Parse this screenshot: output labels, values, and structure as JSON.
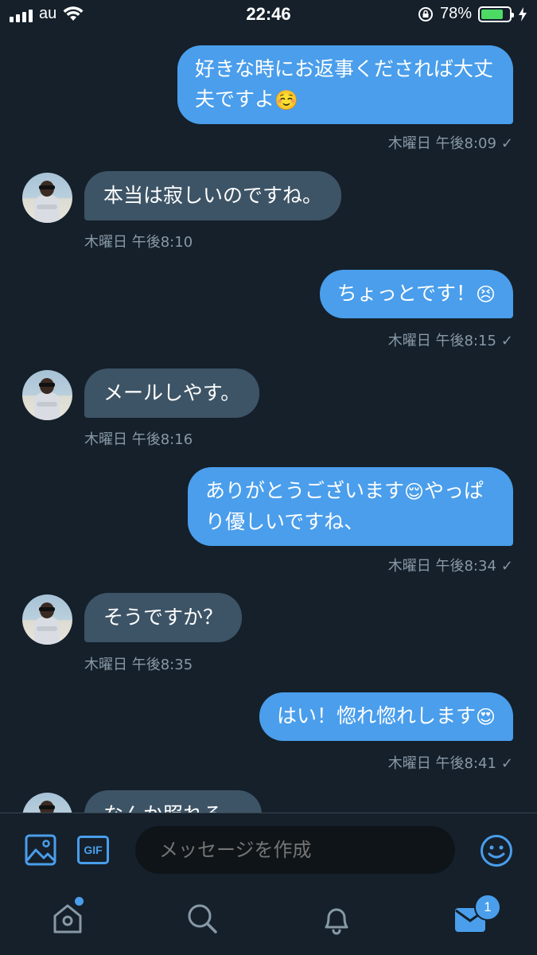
{
  "status_bar": {
    "carrier": "au",
    "time": "22:46",
    "battery_percent": "78%",
    "battery_level": 0.78
  },
  "messages": [
    {
      "direction": "out",
      "text": "好きな時にお返事くだされば大丈夫ですよ",
      "emoji": "☺️",
      "time": "木曜日 午後8:09",
      "read": "✓"
    },
    {
      "direction": "in",
      "text": "本当は寂しいのですね。",
      "time": "木曜日 午後8:10"
    },
    {
      "direction": "out",
      "text": "ちょっとです！",
      "emoji": "😣",
      "time": "木曜日 午後8:15",
      "read": "✓"
    },
    {
      "direction": "in",
      "text": "メールしやす。",
      "time": "木曜日 午後8:16"
    },
    {
      "direction": "out",
      "text": "ありがとうございます",
      "emoji": "😌",
      "text2": "やっぱり優しいですね、",
      "time": "木曜日 午後8:34",
      "read": "✓"
    },
    {
      "direction": "in",
      "text": "そうですか？",
      "time": "木曜日 午後8:35"
    },
    {
      "direction": "out",
      "text": "はい！惚れ惚れします",
      "emoji": "😍",
      "time": "木曜日 午後8:41",
      "read": "✓"
    },
    {
      "direction": "in",
      "text": "なんか照れる…"
    }
  ],
  "composer": {
    "gif_label": "GIF",
    "placeholder": "メッセージを作成"
  },
  "tabbar": {
    "messages_badge": "1"
  },
  "colors": {
    "background": "#15202b",
    "accent": "#4a9eeb",
    "incoming_bubble": "#3d5466",
    "meta_text": "#8899a6"
  },
  "icons": [
    "image-icon",
    "gif-icon",
    "emoji-icon",
    "home-icon",
    "search-icon",
    "notifications-icon",
    "messages-icon"
  ]
}
